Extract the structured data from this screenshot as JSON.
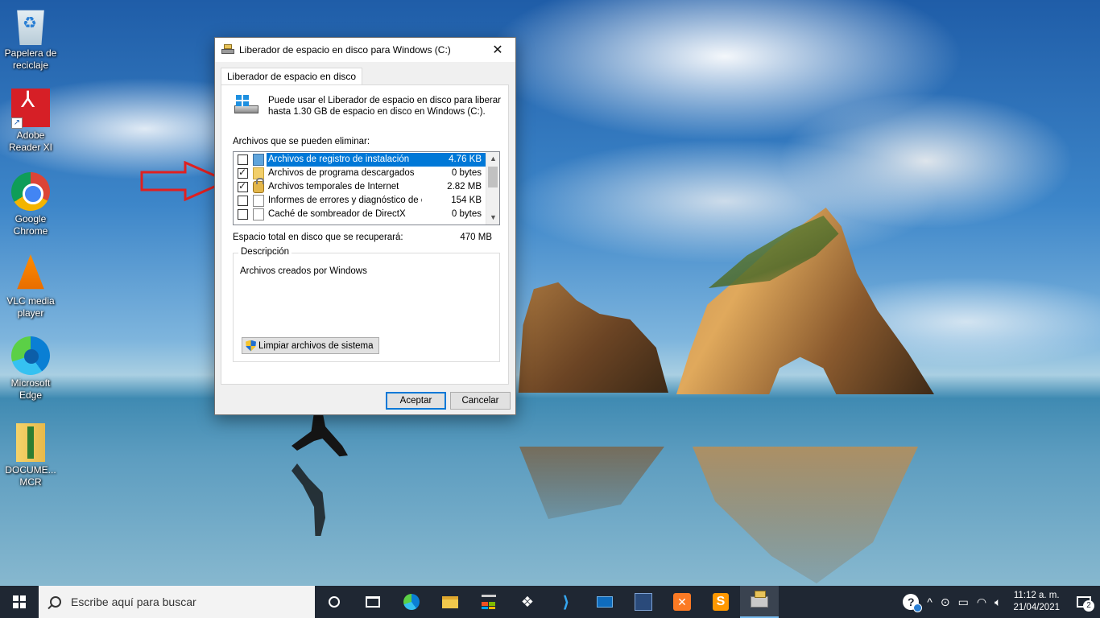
{
  "desktop": {
    "icons": [
      {
        "label": "Papelera de reciclaje",
        "icon": "recycle-bin-icon"
      },
      {
        "label": "Adobe Reader XI",
        "icon": "adobe-reader-icon"
      },
      {
        "label": "Google Chrome",
        "icon": "chrome-icon"
      },
      {
        "label": "VLC media player",
        "icon": "vlc-icon"
      },
      {
        "label": "Microsoft Edge",
        "icon": "edge-icon"
      },
      {
        "label": "DOCUME... MCR",
        "icon": "archive-icon"
      }
    ]
  },
  "dialog": {
    "title": "Liberador de espacio en disco para Windows (C:)",
    "close_glyph": "✕",
    "tab_label": "Liberador de espacio en disco",
    "intro_text": "Puede usar el Liberador de espacio en disco para liberar hasta 1.30 GB de espacio en disco en Windows (C:).",
    "files_label": "Archivos que se pueden eliminar:",
    "files": [
      {
        "name": "Archivos de registro de instalación",
        "size": "4.76 KB",
        "checked": false,
        "selected": true,
        "icon": "blue-file-icon"
      },
      {
        "name": "Archivos de programa descargados",
        "size": "0 bytes",
        "checked": true,
        "selected": false,
        "icon": "folder-icon"
      },
      {
        "name": "Archivos temporales de Internet",
        "size": "2.82 MB",
        "checked": true,
        "selected": false,
        "icon": "lock-icon"
      },
      {
        "name": "Informes de errores y diagnóstico de c...",
        "size": "154 KB",
        "checked": false,
        "selected": false,
        "icon": "page-icon"
      },
      {
        "name": "Caché de sombreador de DirectX",
        "size": "0 bytes",
        "checked": false,
        "selected": false,
        "icon": "page-icon"
      }
    ],
    "total_label": "Espacio total en disco que se recuperará:",
    "total_value": "470 MB",
    "description_legend": "Descripción",
    "description_text": "Archivos creados por Windows",
    "system_button": "Limpiar archivos de sistema",
    "ok_button": "Aceptar",
    "cancel_button": "Cancelar"
  },
  "taskbar": {
    "search_placeholder": "Escribe aquí para buscar",
    "pinned": [
      "cortana-icon",
      "task-view-icon",
      "edge-icon",
      "file-explorer-icon",
      "store-icon",
      "dropbox-icon",
      "visual-studio-icon",
      "mail-icon",
      "mysql-workbench-icon",
      "xampp-icon",
      "sublime-icon",
      "disk-cleanup-icon"
    ],
    "tray": {
      "help_glyph": "?",
      "chevron": "^",
      "time": "11:12 a. m.",
      "date": "21/04/2021",
      "notifications_count": "2"
    }
  },
  "colors": {
    "accent": "#0078d7",
    "taskbar": "#1f2733",
    "arrow": "#e02020"
  }
}
